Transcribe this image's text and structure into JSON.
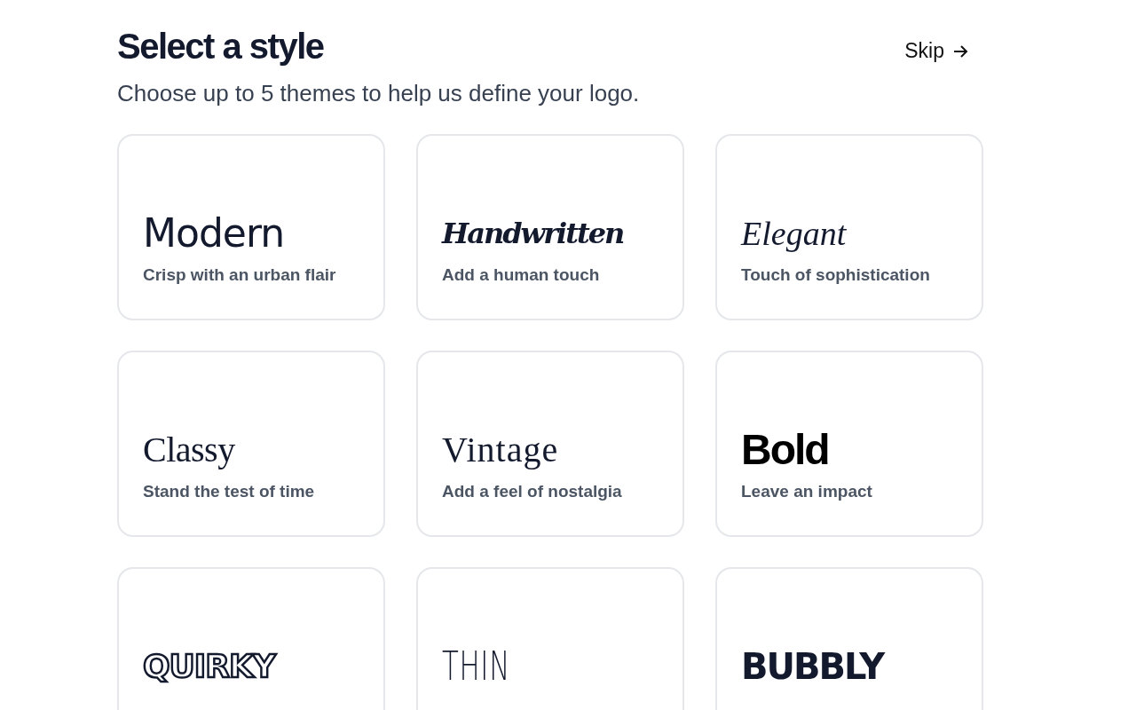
{
  "header": {
    "title": "Select a style",
    "subtitle": "Choose up to 5 themes to help us define your logo.",
    "skip": "Skip"
  },
  "styles": [
    {
      "kind": "modern",
      "name": "Modern",
      "description": "Crisp with an urban flair"
    },
    {
      "kind": "handwritten",
      "name": "Handwritten",
      "description": "Add a human touch"
    },
    {
      "kind": "elegant",
      "name": "Elegant",
      "description": "Touch of sophistication"
    },
    {
      "kind": "classy",
      "name": "Classy",
      "description": "Stand the test of time"
    },
    {
      "kind": "vintage",
      "name": "Vintage",
      "description": "Add a feel of nostalgia"
    },
    {
      "kind": "bold",
      "name": "Bold",
      "description": "Leave an impact"
    },
    {
      "kind": "quirky",
      "name": "QUIRKY"
    },
    {
      "kind": "thin",
      "name": "THIN"
    },
    {
      "kind": "bubbly",
      "name": "BUBBLY"
    }
  ]
}
